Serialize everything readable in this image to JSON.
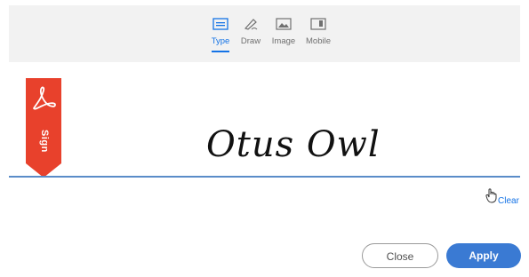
{
  "tabs": [
    {
      "label": "Type",
      "icon": "keyboard-icon",
      "active": true
    },
    {
      "label": "Draw",
      "icon": "pen-icon",
      "active": false
    },
    {
      "label": "Image",
      "icon": "image-icon",
      "active": false
    },
    {
      "label": "Mobile",
      "icon": "mobile-icon",
      "active": false
    }
  ],
  "ribbon": {
    "label": "Sign",
    "icon": "acrobat-icon",
    "color": "#e8412c"
  },
  "signature": {
    "text": "Otus Owl"
  },
  "clear": {
    "label": "Clear"
  },
  "buttons": {
    "close_label": "Close",
    "apply_label": "Apply"
  },
  "colors": {
    "accent": "#1473e6",
    "apply": "#3a7ad3",
    "line": "#5a8cc8"
  }
}
